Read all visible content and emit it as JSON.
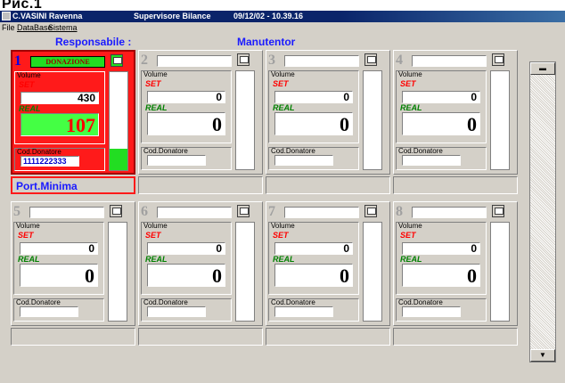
{
  "heading": "Рис.1",
  "titlebar": {
    "app_title": "C.VASINI   Ravenna",
    "role": "Supervisore  Bilance",
    "datetime": "09/12/02 - 10.39.16"
  },
  "menu": [
    "File",
    "DataBase",
    "Sistema"
  ],
  "headers": {
    "responsabile": "Responsabile :",
    "manutentor": "Manutentor"
  },
  "labels": {
    "volume": "Volume",
    "set": "SET",
    "real": "REAL",
    "cod_donatore": "Cod.Donatore"
  },
  "panels": [
    {
      "number": "1",
      "name": "DONAZIONE",
      "set": "430",
      "real": "107",
      "cod": "1111222333",
      "status": "Port.Minima",
      "fill": 0.22
    },
    {
      "number": "2",
      "name": "",
      "set": "0",
      "real": "0",
      "cod": "",
      "status": "",
      "fill": 0
    },
    {
      "number": "3",
      "name": "",
      "set": "0",
      "real": "0",
      "cod": "",
      "status": "",
      "fill": 0
    },
    {
      "number": "4",
      "name": "",
      "set": "0",
      "real": "0",
      "cod": "",
      "status": "",
      "fill": 0
    },
    {
      "number": "5",
      "name": "",
      "set": "0",
      "real": "0",
      "cod": "",
      "status": "",
      "fill": 0
    },
    {
      "number": "6",
      "name": "",
      "set": "0",
      "real": "0",
      "cod": "",
      "status": "",
      "fill": 0
    },
    {
      "number": "7",
      "name": "",
      "set": "0",
      "real": "0",
      "cod": "",
      "status": "",
      "fill": 0
    },
    {
      "number": "8",
      "name": "",
      "set": "0",
      "real": "0",
      "cod": "",
      "status": "",
      "fill": 0
    }
  ],
  "icons": {
    "monitor": "monitor-icon",
    "scroll_up": "chevron-up-icon",
    "scroll_down": "chevron-down-icon"
  },
  "colors": {
    "active_panel": "#ff1a1a",
    "active_field": "#44ff44",
    "header_text": "#1a1aff",
    "titlebar": "#0a246a"
  }
}
